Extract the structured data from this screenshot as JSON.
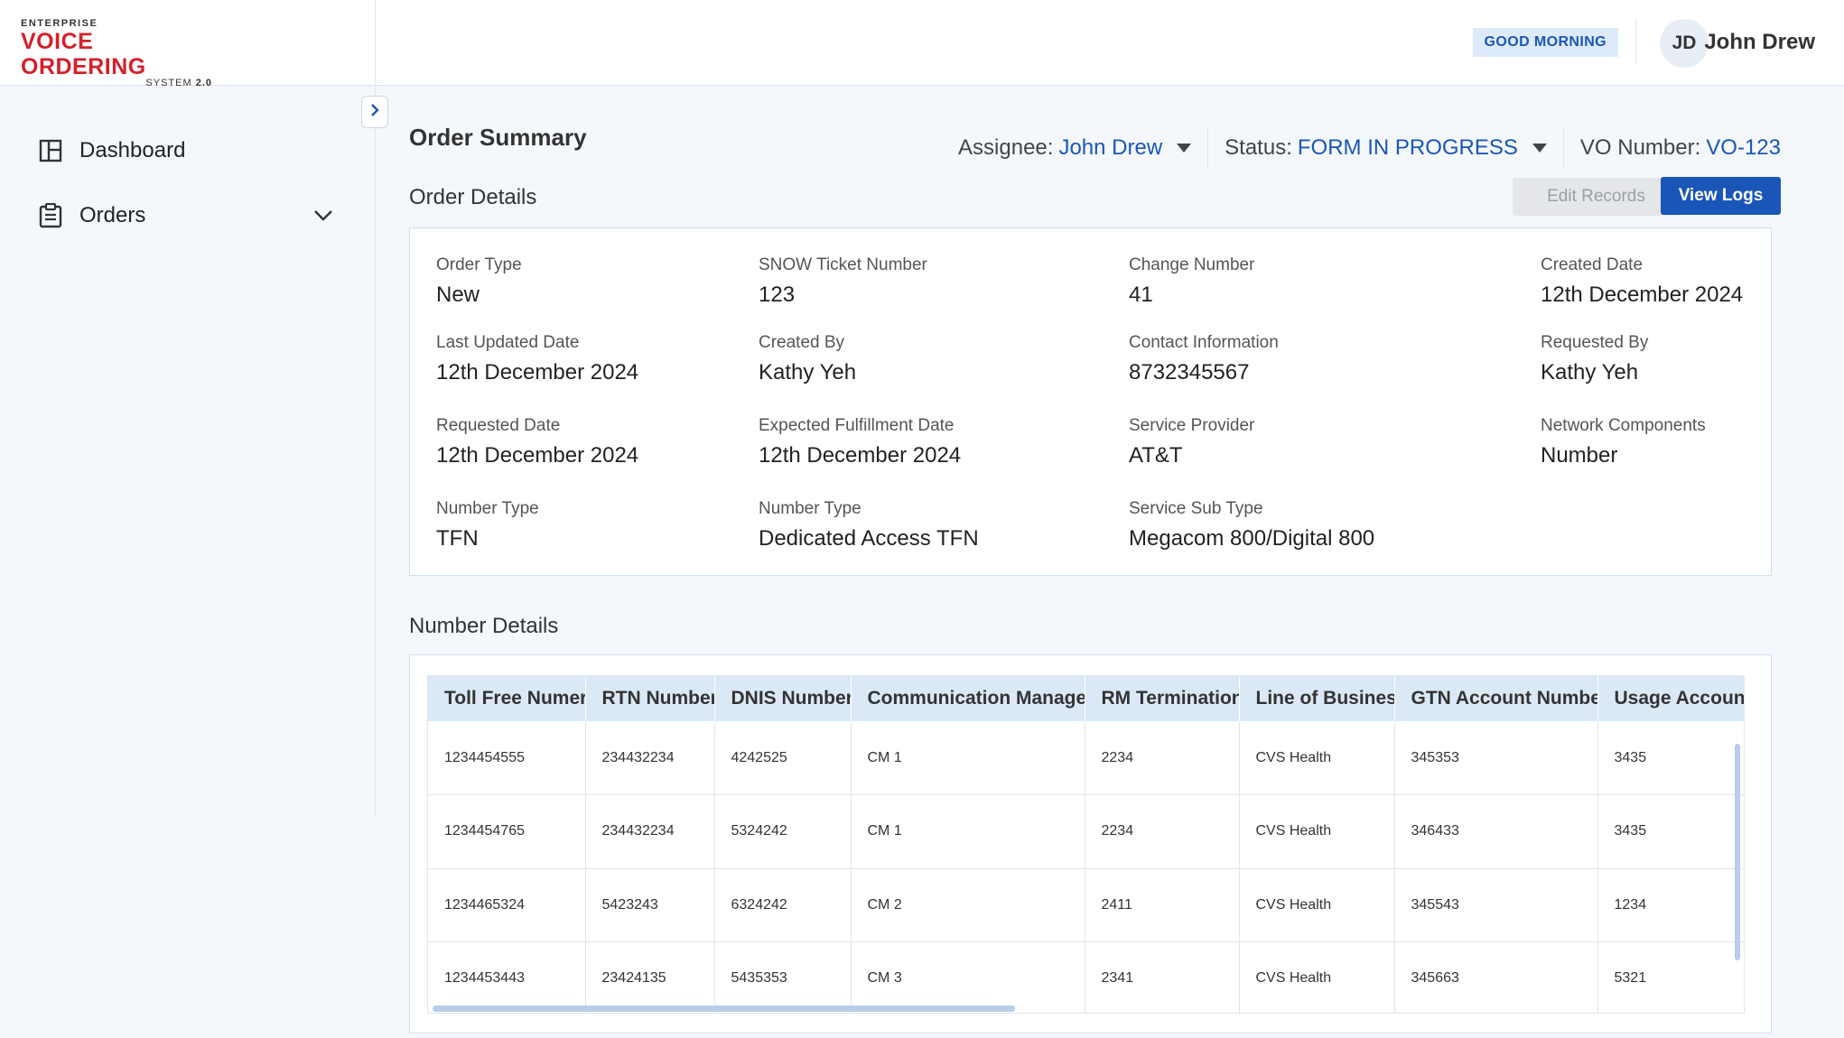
{
  "logo": {
    "top": "ENTERPRISE",
    "main": "VOICE ORDERING",
    "sub": "SYSTEM",
    "version": "2.0"
  },
  "sidebar": {
    "items": [
      {
        "label": "Dashboard",
        "icon": "dashboard-icon"
      },
      {
        "label": "Orders",
        "icon": "clipboard-icon"
      }
    ]
  },
  "header": {
    "greeting": "GOOD MORNING",
    "user_initials": "JD",
    "user_name": "John Drew"
  },
  "page": {
    "title": "Order Summary",
    "assignee_label": "Assignee:",
    "assignee_value": "John Drew",
    "status_label": "Status:",
    "status_value": "FORM IN PROGRESS",
    "vo_label": "VO Number:",
    "vo_value": "VO-123"
  },
  "order_details": {
    "title": "Order Details",
    "edit_label": "Edit Records",
    "logs_label": "View Logs",
    "fields": [
      {
        "label": "Order Type",
        "value": "New"
      },
      {
        "label": "SNOW Ticket Number",
        "value": "123"
      },
      {
        "label": "Change Number",
        "value": "41"
      },
      {
        "label": "Created Date",
        "value": "12th December 2024"
      },
      {
        "label": "Last Updated Date",
        "value": "12th December 2024"
      },
      {
        "label": "Created By",
        "value": "Kathy Yeh"
      },
      {
        "label": "Contact Information",
        "value": "8732345567"
      },
      {
        "label": "Requested By",
        "value": "Kathy Yeh"
      },
      {
        "label": "Requested Date",
        "value": "12th December 2024"
      },
      {
        "label": "Expected Fulfillment Date",
        "value": "12th December 2024"
      },
      {
        "label": "Service Provider",
        "value": "AT&T"
      },
      {
        "label": "Network Components",
        "value": "Number"
      },
      {
        "label": "Number Type",
        "value": "TFN"
      },
      {
        "label": "Number Type",
        "value": "Dedicated Access TFN"
      },
      {
        "label": "Service Sub Type",
        "value": "Megacom 800/Digital 800"
      }
    ]
  },
  "number_details": {
    "title": "Number Details",
    "columns": [
      "Toll Free Numer",
      "RTN Number",
      "DNIS Number",
      "Communication Manager",
      "RM Termination",
      "Line of Business",
      "GTN Account Number",
      "Usage Account Number"
    ],
    "rows": [
      [
        "1234454555",
        "234432234",
        "4242525",
        "CM 1",
        "2234",
        "CVS Health",
        "345353",
        "3435"
      ],
      [
        "1234454765",
        "234432234",
        "5324242",
        "CM 1",
        "2234",
        "CVS Health",
        "346433",
        "3435"
      ],
      [
        "1234465324",
        "5423243",
        "6324242",
        "CM 2",
        "2411",
        "CVS Health",
        "345543",
        "1234"
      ],
      [
        "1234453443",
        "23424135",
        "5435353",
        "CM 3",
        "2341",
        "CVS Health",
        "345663",
        "5321"
      ]
    ]
  },
  "colors": {
    "accent": "#1a56b8",
    "logo_red": "#d6202a",
    "table_header": "#dbe9f7"
  }
}
